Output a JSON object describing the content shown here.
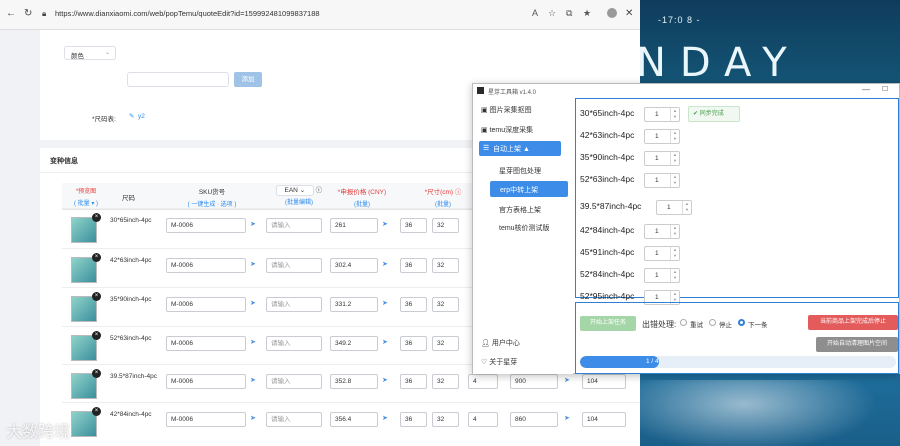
{
  "browser": {
    "url": "https://www.dianxiaomi.com/web/popTemu/quoteEdit?id=159992481099837188",
    "top_icons": [
      "A",
      "☆",
      "⧉",
      "★",
      "⋯"
    ]
  },
  "form": {
    "color_select": "颜色",
    "add_button": "添加",
    "size_chart_label": "*尺码表:",
    "size_chart_value": "y2"
  },
  "variants": {
    "section_title": "变种信息",
    "headers": {
      "preview": "*预览图",
      "preview_batch": "( 批量 ▾ )",
      "size": "尺码",
      "sku": "SKU货号",
      "sku_links": "( 一键生成 · 选项 )",
      "ean": "EAN",
      "ean_batch": "(批量编辑)",
      "price": "*申报价格 (CNY)",
      "price_batch": "(批量)",
      "dims": "*尺寸(cm) ⓘ",
      "dims_batch": "(批量)"
    },
    "rows": [
      {
        "size": "30*65inch-4pc",
        "sku": "M-0006",
        "ean": "请输入",
        "price": "261",
        "d1": "36",
        "d2": "32"
      },
      {
        "size": "42*63inch-4pc",
        "sku": "M-0006",
        "ean": "请输入",
        "price": "302.4",
        "d1": "36",
        "d2": "32"
      },
      {
        "size": "35*90inch-4pc",
        "sku": "M-0006",
        "ean": "请输入",
        "price": "331.2",
        "d1": "36",
        "d2": "32"
      },
      {
        "size": "52*63inch-4pc",
        "sku": "M-0006",
        "ean": "请输入",
        "price": "349.2",
        "d1": "36",
        "d2": "32"
      },
      {
        "size": "39.5*87inch-4pc",
        "sku": "M-0006",
        "ean": "请输入",
        "price": "352.8",
        "d1": "36",
        "d2": "32",
        "d3": "4",
        "d4": "900",
        "d5": "104"
      },
      {
        "size": "42*84inch-4pc",
        "sku": "M-0006",
        "ean": "请输入",
        "price": "356.4",
        "d1": "36",
        "d2": "32",
        "d3": "4",
        "d4": "860",
        "d5": "104"
      }
    ]
  },
  "tool": {
    "title": "星芽工具箱 v1.4.0",
    "sidebar": [
      "图片采集抠图",
      "temu深度采集",
      "自动上架 ▲",
      "星芽图包处理",
      "erp中转上架",
      "官方表格上架",
      "temu核价测试版"
    ],
    "user_center": "用户中心",
    "about": "关于星芽",
    "size_rows": [
      {
        "label": "30*65inch-4pc",
        "qty": "1",
        "status": "同步完成"
      },
      {
        "label": "42*63inch-4pc",
        "qty": "1"
      },
      {
        "label": "35*90inch-4pc",
        "qty": "1"
      },
      {
        "label": "52*63inch-4pc",
        "qty": "1"
      },
      {
        "label": "39.5*87inch-4pc",
        "qty": "1"
      },
      {
        "label": "42*84inch-4pc",
        "qty": "1"
      },
      {
        "label": "45*91inch-4pc",
        "qty": "1"
      },
      {
        "label": "52*84inch-4pc",
        "qty": "1"
      },
      {
        "label": "52*95inch-4pc",
        "qty": "1"
      }
    ],
    "start_button": "开始上架任务",
    "error_label": "出错处理:",
    "opt_retry": "重试",
    "opt_stop": "停止",
    "opt_next": "下一条",
    "stop_after_button": "当前商品上架完成后停止",
    "clear_button": "开始自动清理图片空间",
    "progress_text": "1 / 4",
    "progress": 0.25
  },
  "desktop": {
    "clock": "-17:0 8 -",
    "word": "NDAY"
  },
  "watermark": "大数跨境"
}
